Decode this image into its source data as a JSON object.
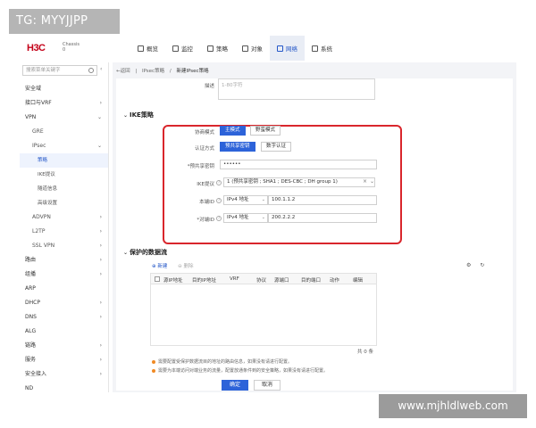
{
  "watermark_tl": "TG: MYYJJPP",
  "watermark_br": "www.mjhldlweb.com",
  "brand": {
    "logo": "H3C",
    "sub1": "Chassis",
    "sub2": "0"
  },
  "topnav": [
    {
      "label": "概览",
      "icon": "overview-icon"
    },
    {
      "label": "监控",
      "icon": "monitor-icon"
    },
    {
      "label": "策略",
      "icon": "policy-icon"
    },
    {
      "label": "对象",
      "icon": "object-icon"
    },
    {
      "label": "网络",
      "icon": "network-icon",
      "active": true
    },
    {
      "label": "系统",
      "icon": "system-icon"
    }
  ],
  "sidebar": {
    "search_placeholder": "搜索菜单关键字",
    "items": [
      {
        "label": "安全域",
        "level": 1
      },
      {
        "label": "接口与VRF",
        "level": 1,
        "chevron": "›"
      },
      {
        "label": "VPN",
        "level": 1,
        "chevron": "⌄"
      },
      {
        "label": "GRE",
        "level": 2
      },
      {
        "label": "IPsec",
        "level": 2,
        "chevron": "⌄"
      },
      {
        "label": "策略",
        "level": 3,
        "active": true
      },
      {
        "label": "IKE提议",
        "level": 3
      },
      {
        "label": "隧道信息",
        "level": 3
      },
      {
        "label": "高级设置",
        "level": 3
      },
      {
        "label": "ADVPN",
        "level": 2,
        "chevron": "›"
      },
      {
        "label": "L2TP",
        "level": 2,
        "chevron": "›"
      },
      {
        "label": "SSL VPN",
        "level": 2,
        "chevron": "›"
      },
      {
        "label": "路由",
        "level": 1,
        "chevron": "›"
      },
      {
        "label": "组播",
        "level": 1,
        "chevron": "›"
      },
      {
        "label": "ARP",
        "level": 1
      },
      {
        "label": "DHCP",
        "level": 1,
        "chevron": "›"
      },
      {
        "label": "DNS",
        "level": 1,
        "chevron": "›"
      },
      {
        "label": "ALG",
        "level": 1
      },
      {
        "label": "链路",
        "level": 1,
        "chevron": "›"
      },
      {
        "label": "服务",
        "level": 1,
        "chevron": "›"
      },
      {
        "label": "安全接入",
        "level": 1,
        "chevron": "›"
      },
      {
        "label": "ND",
        "level": 1
      }
    ]
  },
  "breadcrumb": {
    "back": "←返回",
    "sep": "|",
    "item1": "IPsec策略",
    "sep2": "/",
    "item2": "新建IPsec策略"
  },
  "form": {
    "desc_label": "描述",
    "desc_placeholder": "1-80字符",
    "ike_section": "IKE策略",
    "nego_label": "协商模式",
    "nego_opt1": "主模式",
    "nego_opt2": "野蛮模式",
    "auth_label": "认证方式",
    "auth_opt1": "预共享密钥",
    "auth_opt2": "数字认证",
    "psk_label": "*预共享密钥",
    "psk_value": "••••••",
    "ike_prop_label": "IKE提议",
    "ike_prop_value": "1 (预共享密钥 ; SHA1 ; DES-CBC ; DH group 1)",
    "local_id_label": "本端ID",
    "local_id_type": "IPv4 地址",
    "local_id_value": "100.1.1.2",
    "peer_id_label": "*对端ID",
    "peer_id_type": "IPv4 地址",
    "peer_id_value": "200.2.2.2",
    "flow_section": "保护的数据流"
  },
  "table": {
    "new_label": "⊕ 新建",
    "del_label": "⊖ 删除",
    "columns": [
      "源IP地址",
      "目的IP地址",
      "VRF",
      "协议",
      "源端口",
      "目的端口",
      "动作",
      "编辑"
    ],
    "total": "共 0 条"
  },
  "notes": [
    "需要配置受保护数据流目的地址的路由信息，如果没有请进行配置。",
    "需要为本端访问对端业务的流量，配置放通条件到的安全策略，如果没有请进行配置。"
  ],
  "buttons": {
    "ok": "确定",
    "cancel": "取消"
  }
}
